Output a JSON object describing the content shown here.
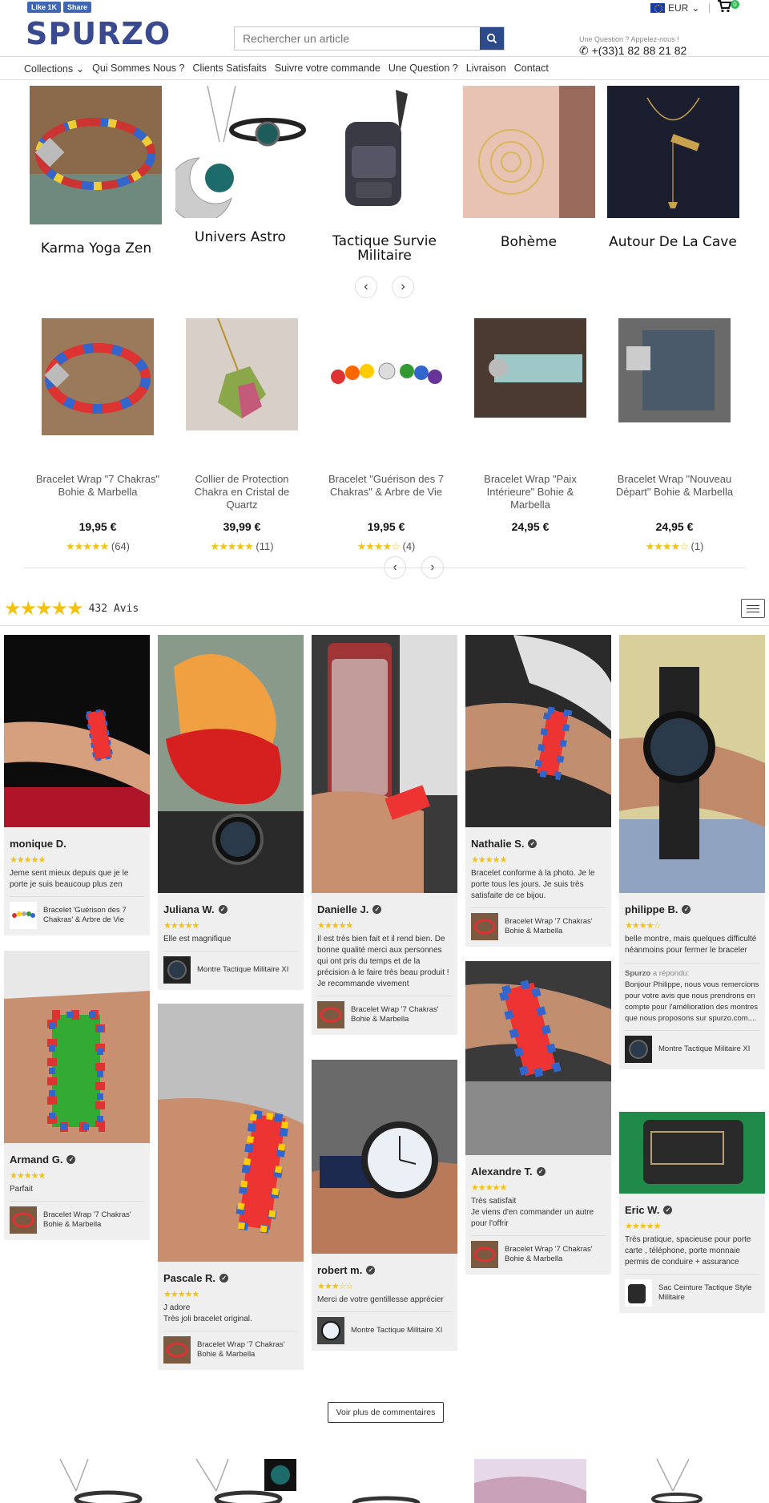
{
  "facebook": {
    "like": "Like 1K",
    "share": "Share"
  },
  "header": {
    "logo": "SPURZO",
    "search_placeholder": "Rechercher un article",
    "currency": "EUR",
    "cart_count": "0",
    "contact_label": "Une Question ? Appelez-nous !",
    "phone": "+(33)1 82 88 21 82"
  },
  "nav": [
    "Collections",
    "Qui Sommes Nous ?",
    "Clients Satisfaits",
    "Suivre votre commande",
    "Une Question ?",
    "Livraison",
    "Contact"
  ],
  "collections": [
    "Karma Yoga Zen",
    "Univers Astro",
    "Tactique Survie Militaire",
    "Bohème",
    "Autour De La Cave"
  ],
  "products": [
    {
      "name": "Bracelet Wrap \"7 Chakras\" Bohie & Marbella",
      "price": "19,95 €",
      "stars": "★★★★★",
      "reviews": "(64)"
    },
    {
      "name": "Collier de Protection Chakra en Cristal de Quartz",
      "price": "39,99 €",
      "stars": "★★★★★",
      "reviews": "(11)"
    },
    {
      "name": "Bracelet \"Guérison des 7 Chakras\" & Arbre de Vie",
      "price": "19,95 €",
      "stars": "★★★★☆",
      "reviews": "(4)"
    },
    {
      "name": "Bracelet Wrap \"Paix Intérieure\" Bohie & Marbella",
      "price": "24,95 €",
      "stars": "",
      "reviews": ""
    },
    {
      "name": "Bracelet Wrap \"Nouveau Départ\" Bohie & Marbella",
      "price": "24,95 €",
      "stars": "★★★★☆",
      "reviews": "(1)"
    }
  ],
  "reviews_header": {
    "stars": "★★★★★",
    "count": "432 Avis"
  },
  "reviews": [
    {
      "name": "monique D.",
      "verified": false,
      "stars": "★★★★★",
      "text": "Jeme sent mieux depuis que je le porte je suis beaucoup plus zen",
      "product": "Bracelet 'Guérison des 7 Chakras' & Arbre de Vie"
    },
    {
      "name": "Armand G.",
      "verified": true,
      "stars": "★★★★★",
      "text": "Parfait",
      "product": "Bracelet Wrap '7 Chakras' Bohie & Marbella"
    },
    {
      "name": "Juliana W.",
      "verified": true,
      "stars": "★★★★★",
      "text": "Elle est magnifique",
      "product": "Montre Tactique Militaire XI"
    },
    {
      "name": "Pascale R.",
      "verified": true,
      "stars": "★★★★★",
      "text": "J adore\nTrès joli bracelet original.",
      "product": "Bracelet Wrap '7 Chakras' Bohie & Marbella"
    },
    {
      "name": "Danielle J.",
      "verified": true,
      "stars": "★★★★★",
      "text": "Il est très bien fait et il rend bien. De bonne qualité merci aux personnes qui ont pris du temps et de la précision à le faire très beau produit ! Je recommande vivement",
      "product": "Bracelet Wrap '7 Chakras' Bohie & Marbella"
    },
    {
      "name": "robert m.",
      "verified": true,
      "stars": "★★★☆☆",
      "text": "Merci de votre gentillesse apprécier",
      "product": "Montre Tactique Militaire XI"
    },
    {
      "name": "Nathalie S.",
      "verified": true,
      "stars": "★★★★★",
      "text": "Bracelet conforme à la photo. Je le porte tous les jours. Je suis très satisfaite de ce bijou.",
      "product": "Bracelet Wrap '7 Chakras' Bohie & Marbella"
    },
    {
      "name": "Alexandre T.",
      "verified": true,
      "stars": "★★★★★",
      "text": "Très satisfait\nJe viens d'en commander un autre pour l'offrir",
      "product": "Bracelet Wrap '7 Chakras' Bohie & Marbella"
    },
    {
      "name": "philippe B.",
      "verified": true,
      "stars": "★★★★☆",
      "text": "belle montre, mais quelques difficulté néanmoins pour fermer le braceler",
      "reply_author": "Spurzo",
      "reply_label": "a répondu:",
      "reply": "Bonjour Philippe, nous vous remercions pour votre avis que nous prendrons en compte pour l'amélioration des montres que nous proposons sur spurzo.com....",
      "product": "Montre Tactique Militaire XI"
    },
    {
      "name": "Eric W.",
      "verified": true,
      "stars": "★★★★★",
      "text": "Très pratique, spacieuse pour porte carte , téléphone, porte monnaie permis de conduire + assurance",
      "product": "Sac Ceinture Tactique Style Militaire"
    }
  ],
  "more_button": "Voir plus de commentaires",
  "colors": {
    "brand": "#3a4a8f",
    "search_button": "#2d4a8a",
    "star": "#f4c20d",
    "card_bg": "#efefef",
    "facebook": "#4267b2"
  }
}
